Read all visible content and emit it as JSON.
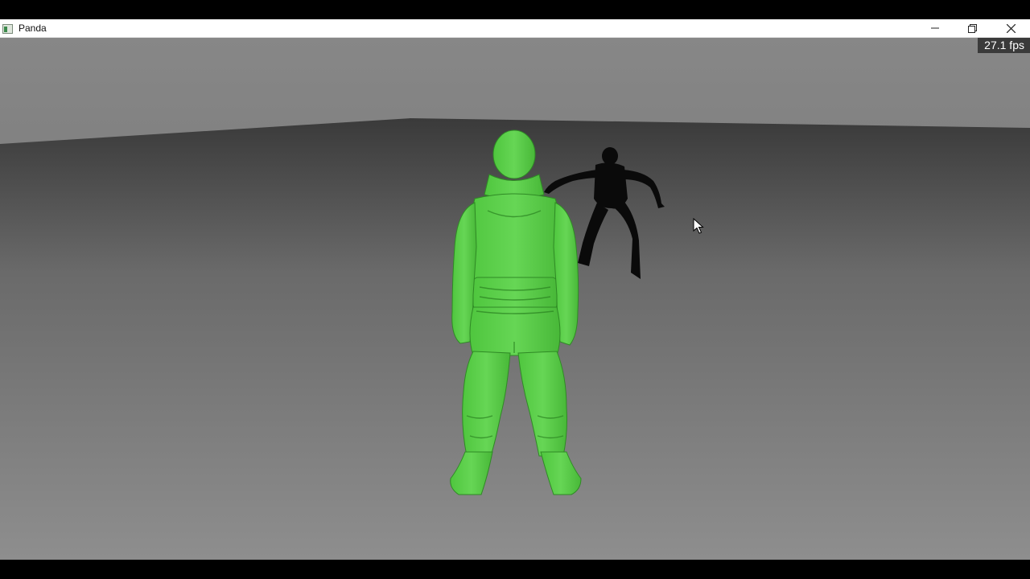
{
  "window": {
    "title": "Panda",
    "controls": {
      "minimize": "minimize",
      "maximize": "restore",
      "close": "close"
    }
  },
  "viewport": {
    "fps_text": "27.1 fps",
    "colors": {
      "sky_top": "#8a8a8a",
      "sky_bottom": "#6e6e6e",
      "ground_far": "#3c3c3c",
      "ground_near": "#8c8c8c",
      "character_main": "#55cc44",
      "character_shadow_figure": "#0a0a0a"
    }
  },
  "icons": {
    "app": "panda-app-icon",
    "cursor": "mouse-pointer-icon"
  }
}
